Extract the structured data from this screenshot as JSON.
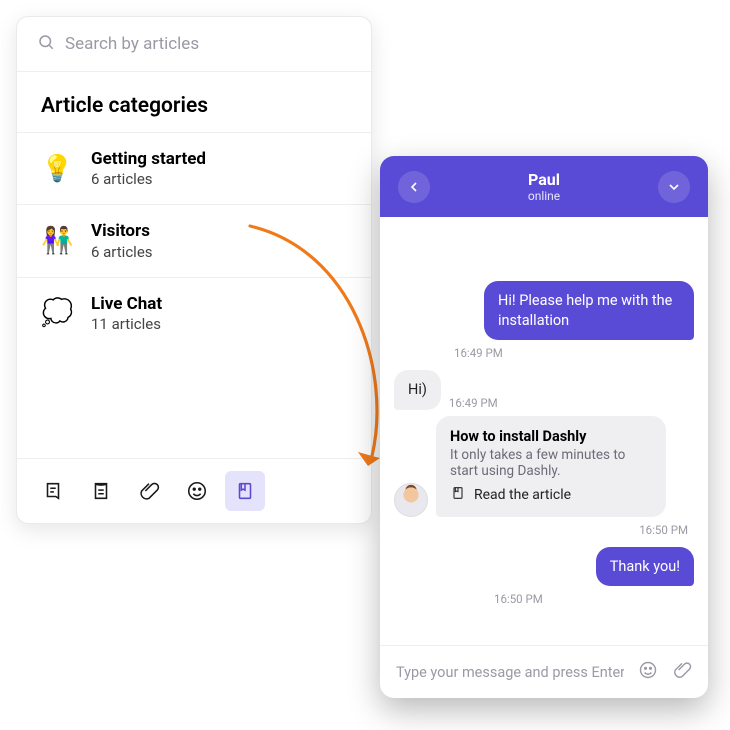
{
  "kb": {
    "search_placeholder": "Search by articles",
    "section_title": "Article categories",
    "items": [
      {
        "icon": "💡",
        "title": "Getting started",
        "sub": "6 articles"
      },
      {
        "icon": "👫",
        "title": "Visitors",
        "sub": "6 articles"
      },
      {
        "icon": "💭",
        "title": "Live Chat",
        "sub": "11 articles"
      }
    ]
  },
  "chat": {
    "name": "Paul",
    "status": "online",
    "input_placeholder": "Type your message and press Enter",
    "messages": {
      "m1": {
        "text": "Hi! Please help me with the installation",
        "time": "16:49 PM"
      },
      "m2": {
        "text": "Hi)",
        "time": "16:49 PM"
      },
      "article": {
        "title": "How to install Dashly",
        "desc": "It only takes a few minutes to start using Dashly.",
        "link": "Read the article",
        "time": "16:50 PM"
      },
      "m3": {
        "text": "Thank you!",
        "time": "16:50 PM"
      }
    }
  }
}
